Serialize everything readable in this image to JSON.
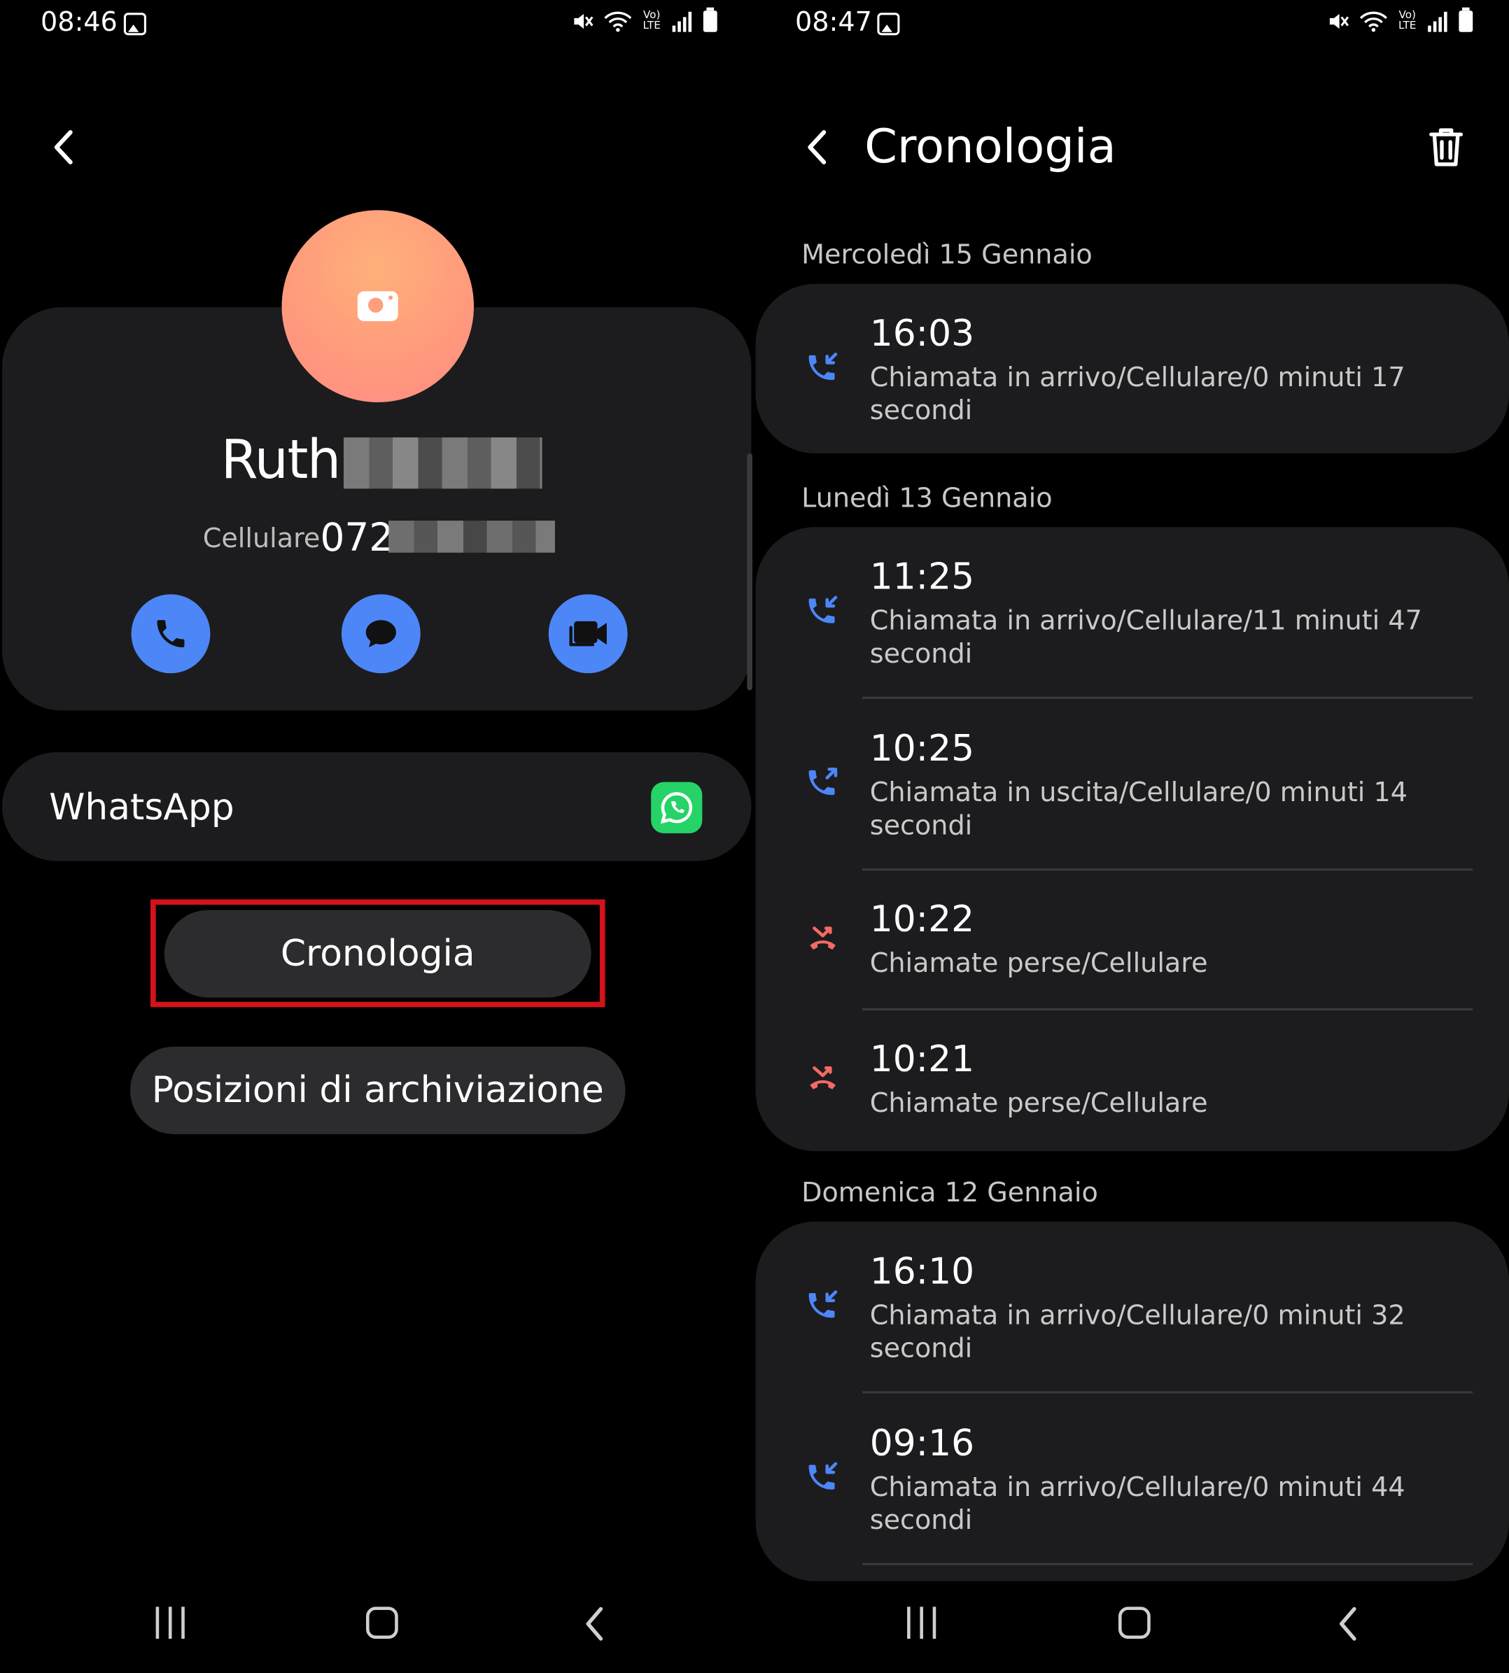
{
  "left_screen": {
    "status": {
      "time": "08:46"
    },
    "contact": {
      "first_name": "Ruth",
      "phone_label": "Cellulare",
      "phone_visible": "072"
    },
    "whatsapp_label": "WhatsApp",
    "history_button": "Cronologia",
    "storage_button": "Posizioni di archiviazione"
  },
  "right_screen": {
    "status": {
      "time": "08:47"
    },
    "title": "Cronologia",
    "groups": [
      {
        "date": "Mercoledì 15 Gennaio",
        "entries": [
          {
            "time": "16:03",
            "type": "incoming",
            "desc": "Chiamata in arrivo/Cellulare/0 minuti 17 secondi"
          }
        ]
      },
      {
        "date": "Lunedì 13 Gennaio",
        "entries": [
          {
            "time": "11:25",
            "type": "incoming",
            "desc": "Chiamata in arrivo/Cellulare/11 minuti 47 secondi"
          },
          {
            "time": "10:25",
            "type": "outgoing",
            "desc": "Chiamata in uscita/Cellulare/0 minuti 14 secondi"
          },
          {
            "time": "10:22",
            "type": "missed",
            "desc": "Chiamate perse/Cellulare"
          },
          {
            "time": "10:21",
            "type": "missed",
            "desc": "Chiamate perse/Cellulare"
          }
        ]
      },
      {
        "date": "Domenica 12 Gennaio",
        "entries": [
          {
            "time": "16:10",
            "type": "incoming",
            "desc": "Chiamata in arrivo/Cellulare/0 minuti 32 secondi"
          },
          {
            "time": "09:16",
            "type": "incoming",
            "desc": "Chiamata in arrivo/Cellulare/0 minuti 44 secondi"
          }
        ]
      }
    ]
  },
  "colors": {
    "accent_blue": "#4d86f7",
    "missed_red": "#f46a64",
    "highlight_red": "#d4121a",
    "card_bg": "#1c1c1e",
    "whatsapp_green": "#25d366"
  },
  "icons": [
    "image-icon",
    "mute-icon",
    "wifi-icon",
    "volte-icon",
    "signal-icon",
    "battery-icon",
    "back-icon",
    "camera-icon",
    "phone-icon",
    "message-icon",
    "video-icon",
    "whatsapp-icon",
    "trash-icon",
    "incoming-call-icon",
    "outgoing-call-icon",
    "missed-call-icon",
    "recent-apps-icon",
    "home-icon"
  ]
}
